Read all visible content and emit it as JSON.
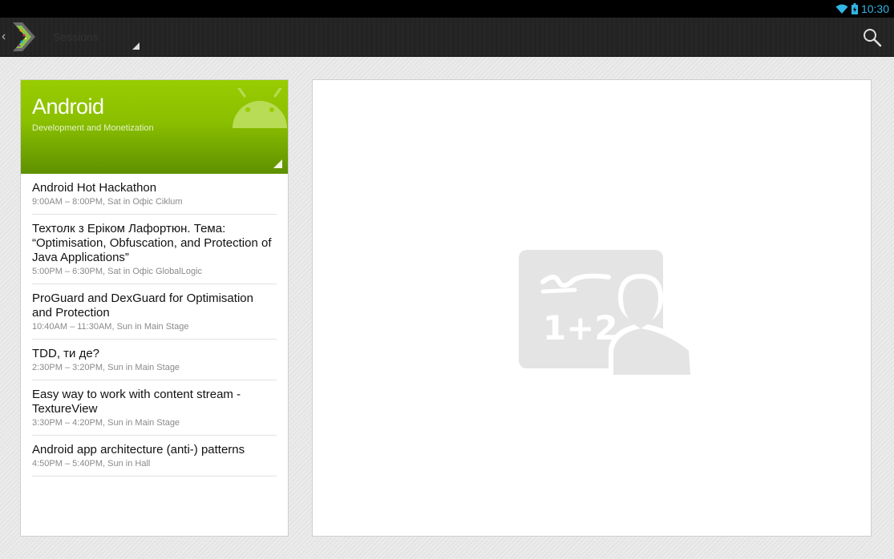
{
  "status_bar": {
    "time": "10:30",
    "icons": [
      "wifi-icon",
      "battery-icon"
    ],
    "accent": "#33b5e5"
  },
  "action_bar": {
    "navigation_title": "Sessions",
    "icons": [
      "up-caret-icon",
      "app-logo-icon",
      "search-icon"
    ]
  },
  "track": {
    "title": "Android",
    "subtitle": "Development and Monetization",
    "color": "#99cc00"
  },
  "sessions": [
    {
      "title": "Android Hot Hackathon",
      "meta": "9:00AM – 8:00PM, Sat in Офіс Ciklum"
    },
    {
      "title": "Техтолк з Еріком Лафортюн. Тема: “Optimisation, Obfuscation, and Protection of Java Applications”",
      "meta": "5:00PM – 6:30PM, Sat in Офіс GlobalLogic"
    },
    {
      "title": "ProGuard and DexGuard for Optimisation and Protection",
      "meta": "10:40AM – 11:30AM, Sun in Main Stage"
    },
    {
      "title": "TDD, ти де?",
      "meta": "2:30PM – 3:20PM, Sun in Main Stage"
    },
    {
      "title": "Easy way to work with content stream - TextureView",
      "meta": "3:30PM – 4:20PM, Sun in Main Stage"
    },
    {
      "title": "Android app architecture (anti-) patterns",
      "meta": "4:50PM – 5:40PM, Sun in Hall"
    }
  ],
  "detail_panel": {
    "icon": "teacher-board-icon"
  }
}
